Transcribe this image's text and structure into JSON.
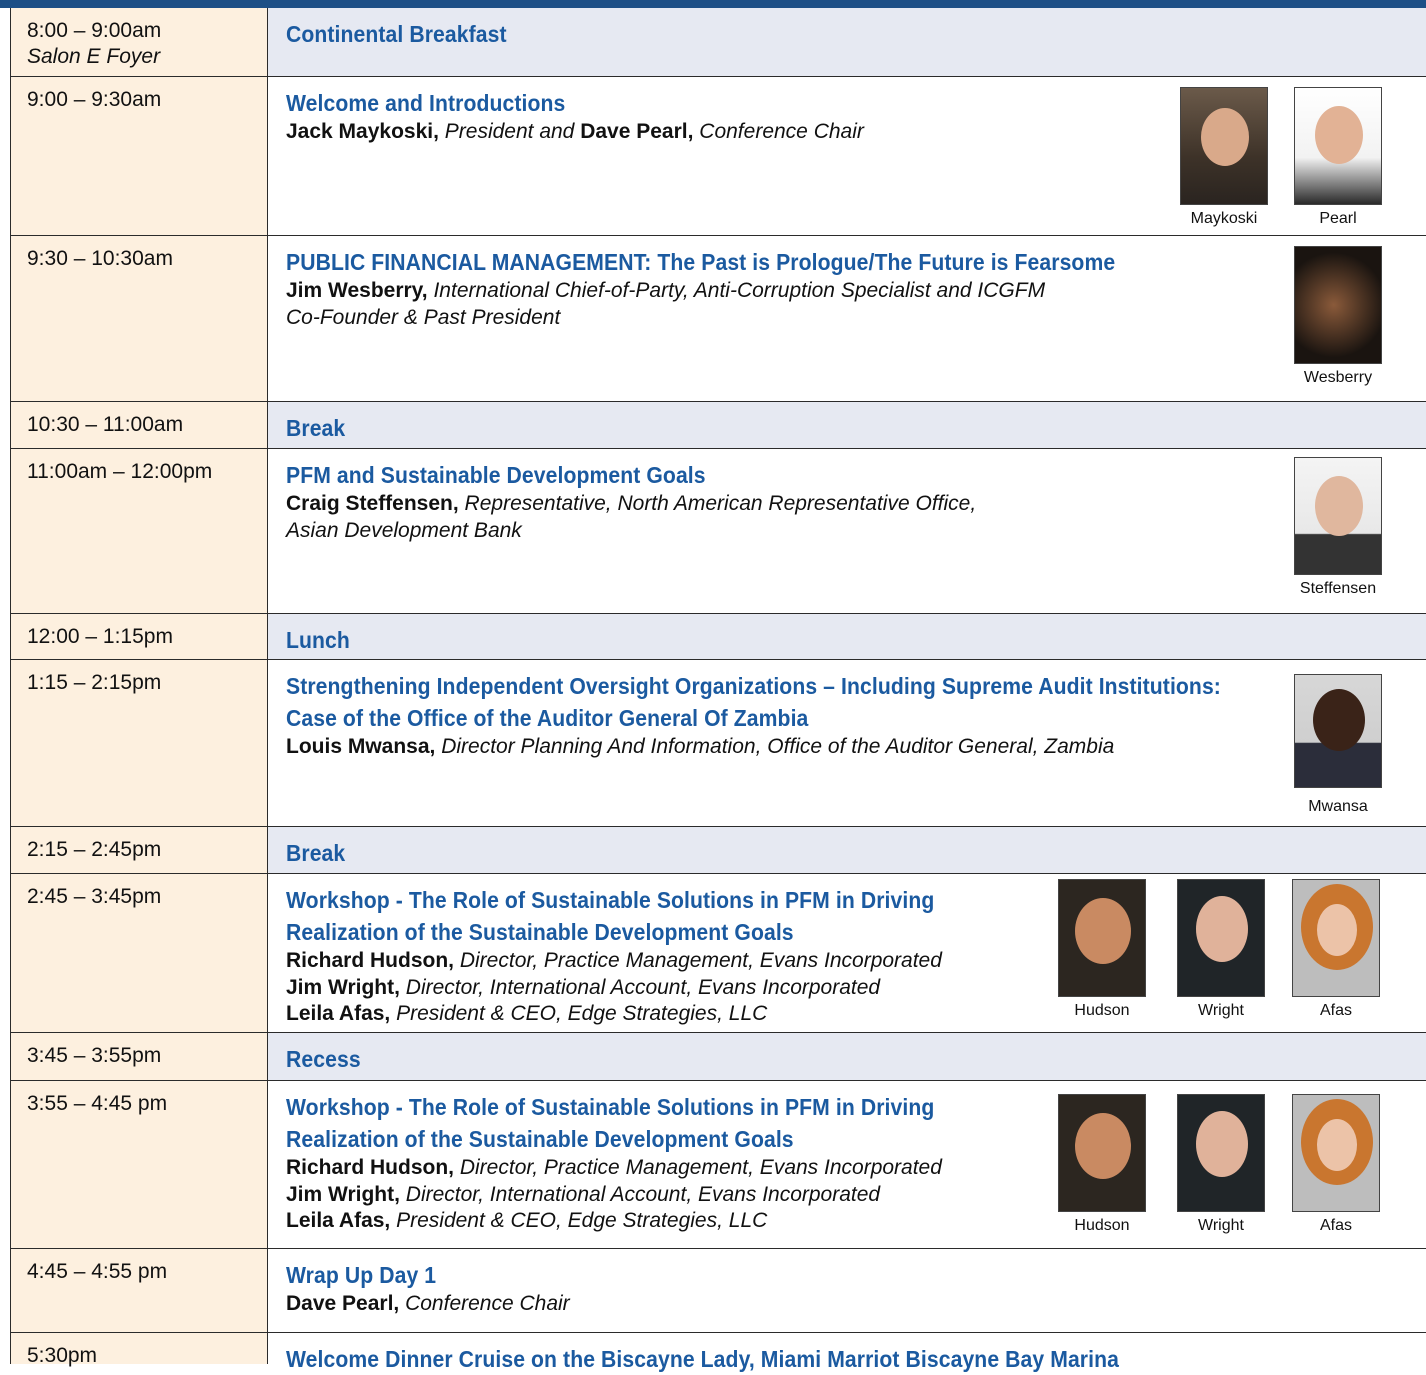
{
  "rows": [
    {
      "time": "8:00 – 9:00am",
      "location": "Salon E Foyer",
      "title": "Continental Breakfast"
    },
    {
      "time": "9:00 – 9:30am",
      "title": "Welcome and Introductions",
      "speakers": [
        {
          "name": "Jack Maykoski,",
          "role": " President and "
        },
        {
          "name": "Dave Pearl,",
          "role": " Conference Chair"
        }
      ],
      "photos": [
        "Maykoski",
        "Pearl"
      ]
    },
    {
      "time": "9:30 – 10:30am",
      "title": "PUBLIC FINANCIAL MANAGEMENT:  The Past is Prologue/The Future is Fearsome",
      "speaker": {
        "name": "Jim Wesberry,",
        "role": " International Chief-of-Party, Anti-Corruption Specialist and ICGFM",
        "role2": "Co-Founder & Past President"
      },
      "photos": [
        "Wesberry"
      ]
    },
    {
      "time": "10:30 – 11:00am",
      "title": "Break"
    },
    {
      "time": "11:00am – 12:00pm",
      "title": "PFM and Sustainable Development Goals",
      "speaker": {
        "name": "Craig Steffensen,",
        "role": " Representative, North American Representative Office,",
        "role2": "Asian Development Bank"
      },
      "photos": [
        "Steffensen"
      ]
    },
    {
      "time": "12:00 – 1:15pm",
      "title": "Lunch"
    },
    {
      "time": "1:15 – 2:15pm",
      "title": "Strengthening Independent Oversight Organizations – Including Supreme Audit Institutions:",
      "title2": "Case of the Office of the Auditor General Of Zambia",
      "speaker": {
        "name": "Louis Mwansa,",
        "role": " Director Planning And Information, Office of the Auditor General, Zambia"
      },
      "photos": [
        "Mwansa"
      ]
    },
    {
      "time": "2:15 – 2:45pm",
      "title": "Break"
    },
    {
      "time": "2:45 – 3:45pm",
      "title": "Workshop - The Role of Sustainable Solutions in PFM in Driving",
      "title2": "Realization of the Sustainable Development Goals",
      "speakers": [
        {
          "name": "Richard Hudson,",
          "role": " Director, Practice Management, Evans Incorporated"
        },
        {
          "name": "Jim Wright,",
          "role": " Director, International Account, Evans Incorporated"
        },
        {
          "name": "Leila Afas,",
          "role": " President & CEO, Edge Strategies, LLC"
        }
      ],
      "photos": [
        "Hudson",
        "Wright",
        "Afas"
      ]
    },
    {
      "time": "3:45 – 3:55pm",
      "title": "Recess"
    },
    {
      "time": "3:55 – 4:45 pm",
      "title": "Workshop - The Role of Sustainable Solutions in PFM in Driving",
      "title2": "Realization of the Sustainable Development Goals",
      "speakers": [
        {
          "name": "Richard Hudson,",
          "role": " Director, Practice Management, Evans Incorporated"
        },
        {
          "name": "Jim Wright,",
          "role": " Director, International Account, Evans Incorporated"
        },
        {
          "name": "Leila Afas,",
          "role": " President & CEO, Edge Strategies, LLC"
        }
      ],
      "photos": [
        "Hudson",
        "Wright",
        "Afas"
      ]
    },
    {
      "time": "4:45 – 4:55 pm",
      "title": "Wrap Up Day 1",
      "speaker": {
        "name": "Dave Pearl,",
        "role": " Conference Chair"
      }
    },
    {
      "time": "5:30pm",
      "title": "Welcome Dinner Cruise on the Biscayne Lady, Miami Marriot Biscayne Bay Marina"
    }
  ],
  "colors": {
    "title": "#1b5aa0",
    "time_bg": "#fdf0df",
    "shade_bg": "#e6e9f2",
    "header_bar": "#1d4f86"
  }
}
